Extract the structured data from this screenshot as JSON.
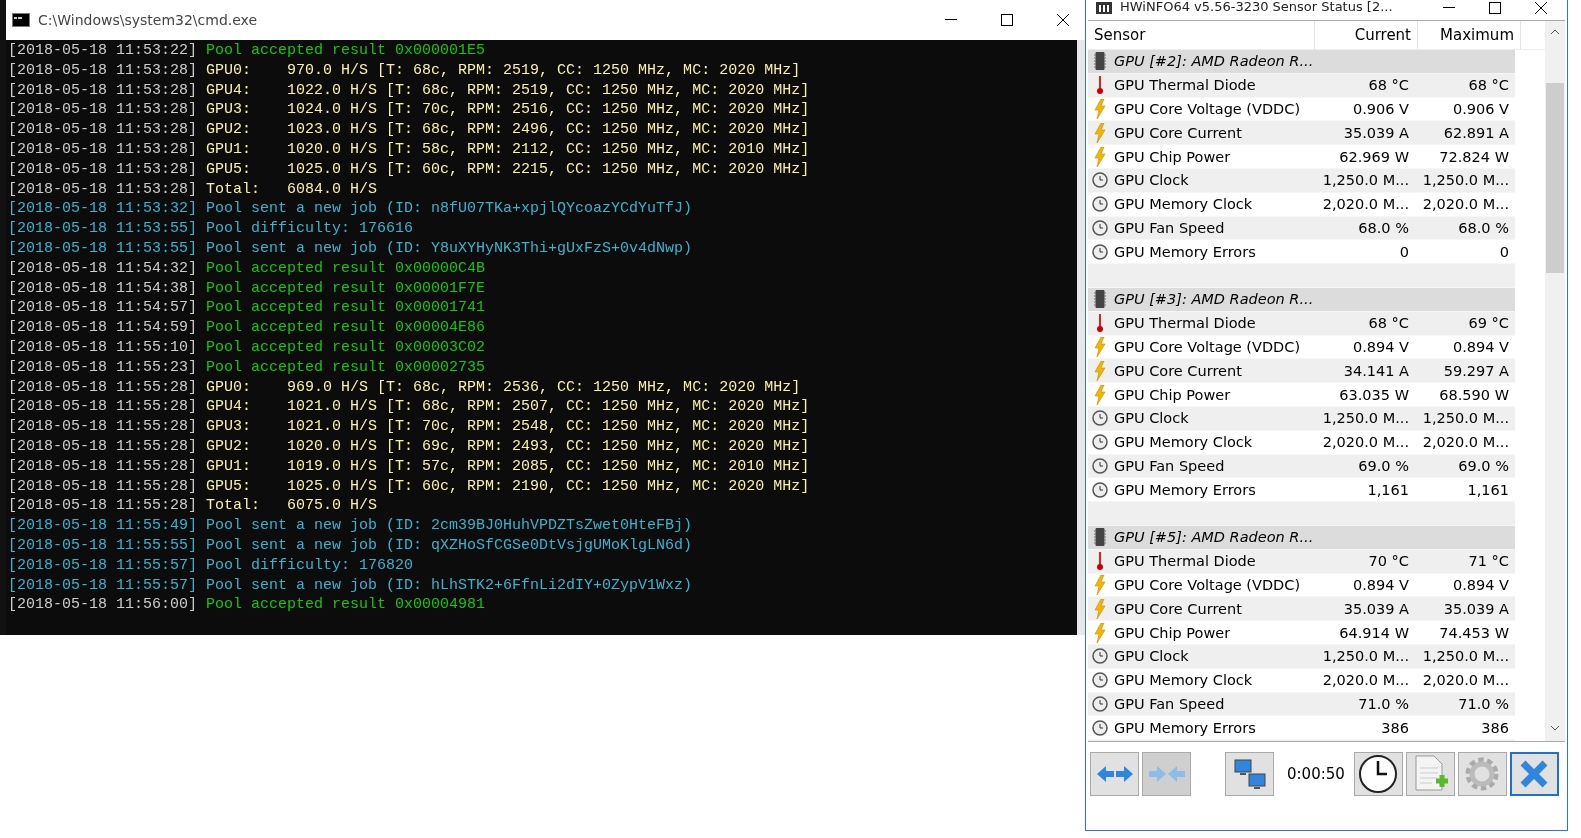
{
  "cmd": {
    "title": "C:\\Windows\\system32\\cmd.exe",
    "lines": [
      {
        "kind": "accepted",
        "timestamp": "[2018-05-18 11:53:22]",
        "text": "Pool accepted result 0x000001E5"
      },
      {
        "kind": "gpu",
        "timestamp": "[2018-05-18 11:53:28]",
        "text": "GPU0:    970.0 H/S [T: 68c, RPM: 2519, CC: 1250 MHz, MC: 2020 MHz]"
      },
      {
        "kind": "gpu",
        "timestamp": "[2018-05-18 11:53:28]",
        "text": "GPU4:    1022.0 H/S [T: 68c, RPM: 2519, CC: 1250 MHz, MC: 2020 MHz]"
      },
      {
        "kind": "gpu",
        "timestamp": "[2018-05-18 11:53:28]",
        "text": "GPU3:    1024.0 H/S [T: 70c, RPM: 2516, CC: 1250 MHz, MC: 2020 MHz]"
      },
      {
        "kind": "gpu",
        "timestamp": "[2018-05-18 11:53:28]",
        "text": "GPU2:    1023.0 H/S [T: 68c, RPM: 2496, CC: 1250 MHz, MC: 2020 MHz]"
      },
      {
        "kind": "gpu",
        "timestamp": "[2018-05-18 11:53:28]",
        "text": "GPU1:    1020.0 H/S [T: 58c, RPM: 2112, CC: 1250 MHz, MC: 2010 MHz]"
      },
      {
        "kind": "gpu",
        "timestamp": "[2018-05-18 11:53:28]",
        "text": "GPU5:    1025.0 H/S [T: 60c, RPM: 2215, CC: 1250 MHz, MC: 2020 MHz]"
      },
      {
        "kind": "gpu",
        "timestamp": "[2018-05-18 11:53:28]",
        "text": "Total:   6084.0 H/S"
      },
      {
        "kind": "job",
        "timestamp": "[2018-05-18 11:53:32]",
        "text": "Pool sent a new job (ID: n8fU07TKa+xpjlQYcoazYCdYuTfJ)"
      },
      {
        "kind": "job",
        "timestamp": "[2018-05-18 11:53:55]",
        "text": "Pool difficulty: 176616"
      },
      {
        "kind": "job",
        "timestamp": "[2018-05-18 11:53:55]",
        "text": "Pool sent a new job (ID: Y8uXYHyNK3Thi+gUxFzS+0v4dNwp)"
      },
      {
        "kind": "accepted",
        "timestamp": "[2018-05-18 11:54:32]",
        "text": "Pool accepted result 0x00000C4B"
      },
      {
        "kind": "accepted",
        "timestamp": "[2018-05-18 11:54:38]",
        "text": "Pool accepted result 0x00001F7E"
      },
      {
        "kind": "accepted",
        "timestamp": "[2018-05-18 11:54:57]",
        "text": "Pool accepted result 0x00001741"
      },
      {
        "kind": "accepted",
        "timestamp": "[2018-05-18 11:54:59]",
        "text": "Pool accepted result 0x00004E86"
      },
      {
        "kind": "accepted",
        "timestamp": "[2018-05-18 11:55:10]",
        "text": "Pool accepted result 0x00003C02"
      },
      {
        "kind": "accepted",
        "timestamp": "[2018-05-18 11:55:23]",
        "text": "Pool accepted result 0x00002735"
      },
      {
        "kind": "gpu",
        "timestamp": "[2018-05-18 11:55:28]",
        "text": "GPU0:    969.0 H/S [T: 68c, RPM: 2536, CC: 1250 MHz, MC: 2020 MHz]"
      },
      {
        "kind": "gpu",
        "timestamp": "[2018-05-18 11:55:28]",
        "text": "GPU4:    1021.0 H/S [T: 68c, RPM: 2507, CC: 1250 MHz, MC: 2020 MHz]"
      },
      {
        "kind": "gpu",
        "timestamp": "[2018-05-18 11:55:28]",
        "text": "GPU3:    1021.0 H/S [T: 70c, RPM: 2548, CC: 1250 MHz, MC: 2020 MHz]"
      },
      {
        "kind": "gpu",
        "timestamp": "[2018-05-18 11:55:28]",
        "text": "GPU2:    1020.0 H/S [T: 69c, RPM: 2493, CC: 1250 MHz, MC: 2020 MHz]"
      },
      {
        "kind": "gpu",
        "timestamp": "[2018-05-18 11:55:28]",
        "text": "GPU1:    1019.0 H/S [T: 57c, RPM: 2085, CC: 1250 MHz, MC: 2010 MHz]"
      },
      {
        "kind": "gpu",
        "timestamp": "[2018-05-18 11:55:28]",
        "text": "GPU5:    1025.0 H/S [T: 60c, RPM: 2190, CC: 1250 MHz, MC: 2020 MHz]"
      },
      {
        "kind": "gpu",
        "timestamp": "[2018-05-18 11:55:28]",
        "text": "Total:   6075.0 H/S"
      },
      {
        "kind": "job",
        "timestamp": "[2018-05-18 11:55:49]",
        "text": "Pool sent a new job (ID: 2cm39BJ0HuhVPDZTsZwet0HteFBj)"
      },
      {
        "kind": "job",
        "timestamp": "[2018-05-18 11:55:55]",
        "text": "Pool sent a new job (ID: qXZHoSfCGSe0DtVsjgUMoKlgLN6d)"
      },
      {
        "kind": "job",
        "timestamp": "[2018-05-18 11:55:57]",
        "text": "Pool difficulty: 176820"
      },
      {
        "kind": "job",
        "timestamp": "[2018-05-18 11:55:57]",
        "text": "Pool sent a new job (ID: hLhSTK2+6FfnLi2dIY+0ZypV1Wxz)"
      },
      {
        "kind": "accepted",
        "timestamp": "[2018-05-18 11:56:00]",
        "text": "Pool accepted result 0x00004981"
      }
    ]
  },
  "hwinfo": {
    "title": "HWiNFO64 v5.56-3230 Sensor Status [2...",
    "columns": [
      "Sensor",
      "Current",
      "Maximum"
    ],
    "groups": [
      {
        "name": "GPU [#2]: AMD Radeon R...",
        "sensors": [
          {
            "kind": "thermal",
            "name": "GPU Thermal Diode",
            "current": "68 °C",
            "maximum": "68 °C"
          },
          {
            "kind": "power",
            "name": "GPU Core Voltage (VDDC)",
            "current": "0.906 V",
            "maximum": "0.906 V"
          },
          {
            "kind": "power",
            "name": "GPU Core Current",
            "current": "35.039 A",
            "maximum": "62.891 A"
          },
          {
            "kind": "power",
            "name": "GPU Chip Power",
            "current": "62.969 W",
            "maximum": "72.824 W"
          },
          {
            "kind": "clock",
            "name": "GPU Clock",
            "current": "1,250.0 M...",
            "maximum": "1,250.0 M..."
          },
          {
            "kind": "clock",
            "name": "GPU Memory Clock",
            "current": "2,020.0 M...",
            "maximum": "2,020.0 M..."
          },
          {
            "kind": "clock",
            "name": "GPU Fan Speed",
            "current": "68.0 %",
            "maximum": "68.0 %"
          },
          {
            "kind": "clock",
            "name": "GPU Memory Errors",
            "current": "0",
            "maximum": "0"
          }
        ]
      },
      {
        "name": "GPU [#3]: AMD Radeon R...",
        "sensors": [
          {
            "kind": "thermal",
            "name": "GPU Thermal Diode",
            "current": "68 °C",
            "maximum": "69 °C"
          },
          {
            "kind": "power",
            "name": "GPU Core Voltage (VDDC)",
            "current": "0.894 V",
            "maximum": "0.894 V"
          },
          {
            "kind": "power",
            "name": "GPU Core Current",
            "current": "34.141 A",
            "maximum": "59.297 A"
          },
          {
            "kind": "power",
            "name": "GPU Chip Power",
            "current": "63.035 W",
            "maximum": "68.590 W"
          },
          {
            "kind": "clock",
            "name": "GPU Clock",
            "current": "1,250.0 M...",
            "maximum": "1,250.0 M..."
          },
          {
            "kind": "clock",
            "name": "GPU Memory Clock",
            "current": "2,020.0 M...",
            "maximum": "2,020.0 M..."
          },
          {
            "kind": "clock",
            "name": "GPU Fan Speed",
            "current": "69.0 %",
            "maximum": "69.0 %"
          },
          {
            "kind": "clock",
            "name": "GPU Memory Errors",
            "current": "1,161",
            "maximum": "1,161"
          }
        ]
      },
      {
        "name": "GPU [#5]: AMD Radeon R...",
        "sensors": [
          {
            "kind": "thermal",
            "name": "GPU Thermal Diode",
            "current": "70 °C",
            "maximum": "71 °C"
          },
          {
            "kind": "power",
            "name": "GPU Core Voltage (VDDC)",
            "current": "0.894 V",
            "maximum": "0.894 V"
          },
          {
            "kind": "power",
            "name": "GPU Core Current",
            "current": "35.039 A",
            "maximum": "35.039 A"
          },
          {
            "kind": "power",
            "name": "GPU Chip Power",
            "current": "64.914 W",
            "maximum": "74.453 W"
          },
          {
            "kind": "clock",
            "name": "GPU Clock",
            "current": "1,250.0 M...",
            "maximum": "1,250.0 M..."
          },
          {
            "kind": "clock",
            "name": "GPU Memory Clock",
            "current": "2,020.0 M...",
            "maximum": "2,020.0 M..."
          },
          {
            "kind": "clock",
            "name": "GPU Fan Speed",
            "current": "71.0 %",
            "maximum": "71.0 %"
          },
          {
            "kind": "clock",
            "name": "GPU Memory Errors",
            "current": "386",
            "maximum": "386"
          }
        ]
      }
    ],
    "timer": "0:00:50"
  }
}
